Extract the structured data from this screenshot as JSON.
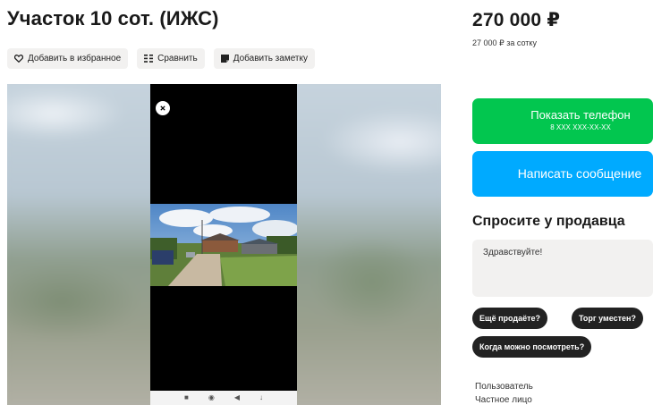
{
  "listing": {
    "title": "Участок 10 сот. (ИЖС)",
    "price": "270 000 ₽",
    "price_per_unit": "27 000 ₽ за сотку"
  },
  "actions": {
    "favorite_label": "Добавить в избранное",
    "compare_label": "Сравнить",
    "note_label": "Добавить заметку"
  },
  "contact": {
    "show_phone_label": "Показать телефон",
    "phone_mask": "8 XXX XXX-XX-XX",
    "message_label": "Написать сообщение"
  },
  "ask_seller": {
    "title": "Спросите у продавца",
    "input_value": "Здравствуйте!",
    "quick_questions": [
      "Ещё продаёте?",
      "Торг уместен?",
      "Когда можно посмотреть?"
    ]
  },
  "seller": {
    "label": "Пользователь",
    "type": "Частное лицо"
  },
  "icons": {
    "favorite": "heart-icon",
    "compare": "compare-icon",
    "note": "note-icon",
    "close": "close-icon"
  },
  "colors": {
    "phone_button": "#02c64f",
    "message_button": "#00aaff",
    "chip": "#222222",
    "chip_bg": "#f2f1f0"
  }
}
